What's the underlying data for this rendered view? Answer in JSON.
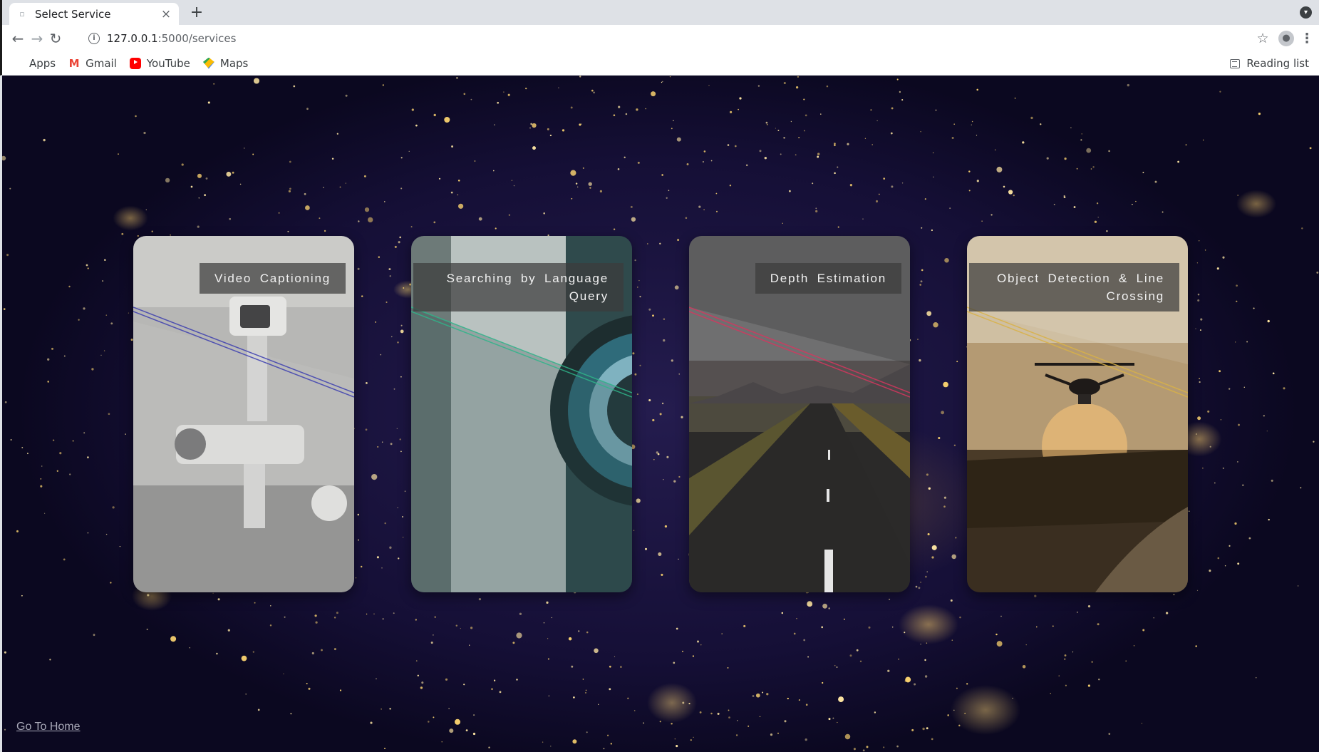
{
  "browser": {
    "tab_title": "Select Service",
    "tab_close": "×",
    "new_tab": "+",
    "url_host": "127.0.0.1",
    "url_path": ":5000/services",
    "info_icon_text": "i",
    "bookmarks": [
      {
        "label": "Apps",
        "icon": "apps-icon"
      },
      {
        "label": "Gmail",
        "icon": "gmail-icon"
      },
      {
        "label": "YouTube",
        "icon": "youtube-icon"
      },
      {
        "label": "Maps",
        "icon": "maps-icon"
      }
    ],
    "reading_list": "Reading list",
    "gmail_glyph": "M"
  },
  "services": [
    {
      "label": "Video Captioning",
      "line_color": "#3d3fb0"
    },
    {
      "label": "Searching by Language Query",
      "line_color": "#2fb58a"
    },
    {
      "label": "Depth Estimation",
      "line_color": "#d6365f"
    },
    {
      "label": "Object Detection & Line Crossing",
      "line_color": "#d9b247"
    }
  ],
  "footer": {
    "home_link": "Go To Home"
  }
}
